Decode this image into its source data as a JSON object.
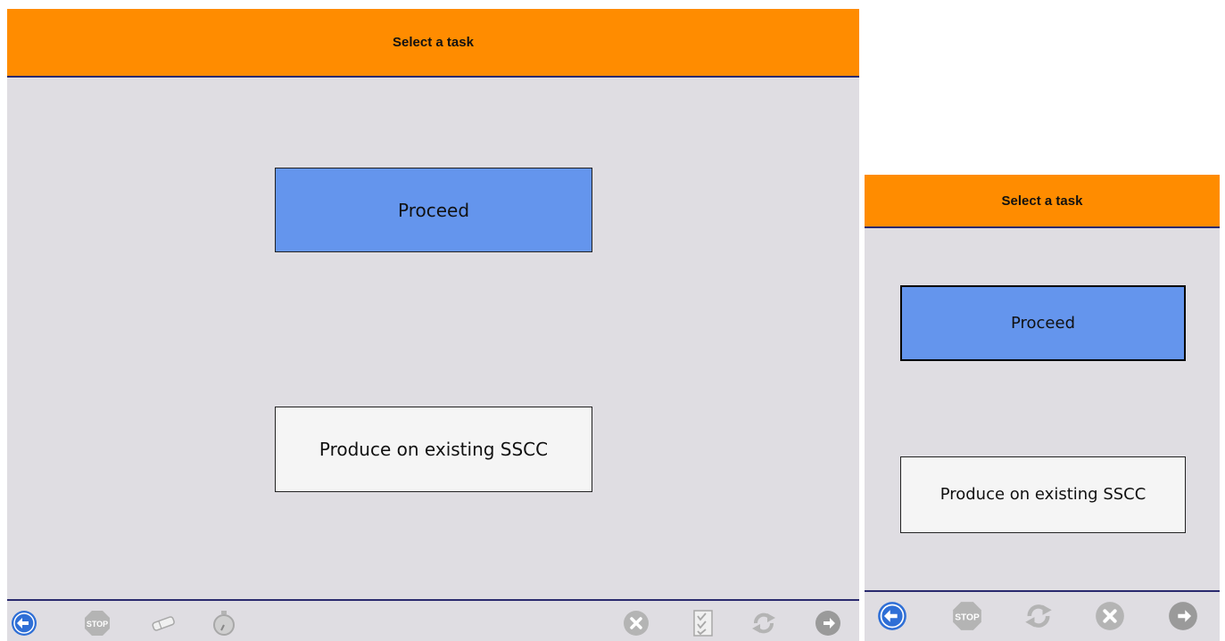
{
  "large_view": {
    "header": {
      "title": "Select a task"
    },
    "buttons": {
      "proceed": "Proceed",
      "produce": "Produce on existing SSCC"
    },
    "toolbar": {
      "left": [
        "back-icon",
        "stop-icon",
        "eraser-icon",
        "stopwatch-icon"
      ],
      "right": [
        "cancel-icon",
        "checklist-icon",
        "refresh-icon",
        "forward-icon"
      ]
    }
  },
  "small_view": {
    "header": {
      "title": "Select a task"
    },
    "buttons": {
      "proceed": "Proceed",
      "produce": "Produce on existing SSCC"
    },
    "toolbar": {
      "icons": [
        "back-icon",
        "stop-icon",
        "refresh-icon",
        "cancel-icon",
        "forward-icon"
      ]
    }
  },
  "colors": {
    "header": "#ff8c00",
    "primary_button": "#6495ed",
    "secondary_button": "#f5f5f5",
    "background": "#dfdde2",
    "active_icon": "#2f6fd6",
    "disabled_icon": "#b4b4b4"
  },
  "icon_labels": {
    "stop": "STOP"
  }
}
